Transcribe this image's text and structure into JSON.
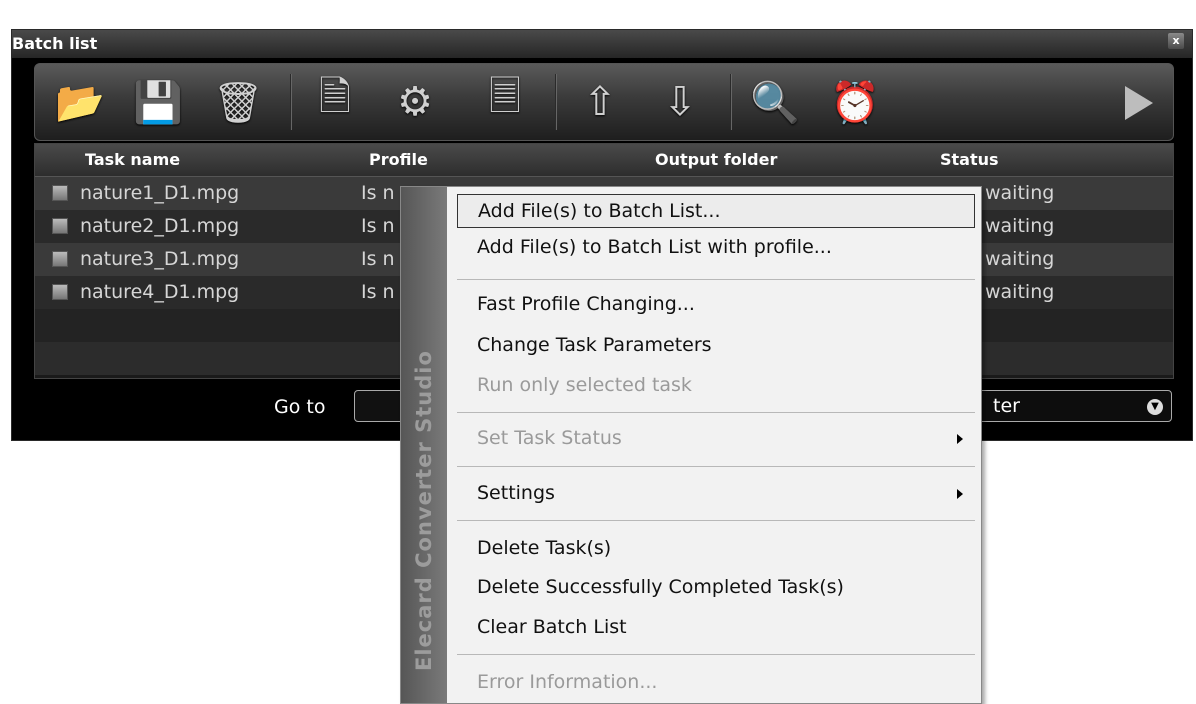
{
  "window": {
    "title": "Batch list",
    "close_label": "x"
  },
  "toolbar": {
    "icons": [
      "open-folder-icon",
      "save-icon",
      "remove-files-icon",
      "delete-task-icon",
      "convert-icon",
      "add-task-icon",
      "move-up-icon",
      "move-down-icon",
      "binoculars-icon",
      "schedule-icon",
      "run-icon"
    ]
  },
  "table": {
    "columns": [
      "Task name",
      "Profile",
      "Output folder",
      "Status"
    ],
    "rows": [
      {
        "task": "nature1_D1.mpg",
        "profile": "Is n",
        "status": "waiting"
      },
      {
        "task": "nature2_D1.mpg",
        "profile": "Is n",
        "status": "waiting"
      },
      {
        "task": "nature3_D1.mpg",
        "profile": "Is n",
        "status": "waiting"
      },
      {
        "task": "nature4_D1.mpg",
        "profile": "Is n",
        "status": "waiting"
      }
    ]
  },
  "footer": {
    "goto_label": "Go to",
    "filter_text": "ter"
  },
  "context_menu": {
    "brand": "Elecard Converter Studio",
    "items": [
      {
        "label": "Add File(s) to Batch List...",
        "enabled": true,
        "highlighted": true
      },
      {
        "label": "Add File(s) to Batch List with profile...",
        "enabled": true
      },
      {
        "label": "Fast Profile Changing...",
        "enabled": true
      },
      {
        "label": "Change Task Parameters",
        "enabled": true
      },
      {
        "label": "Run only selected task",
        "enabled": false
      },
      {
        "label": "Set Task Status",
        "enabled": false,
        "submenu": true
      },
      {
        "label": "Settings",
        "enabled": true,
        "submenu": true
      },
      {
        "label": "Delete Task(s)",
        "enabled": true
      },
      {
        "label": "Delete Successfully Completed Task(s)",
        "enabled": true
      },
      {
        "label": "Clear Batch List",
        "enabled": true
      },
      {
        "label": "Error Information...",
        "enabled": false
      }
    ]
  }
}
